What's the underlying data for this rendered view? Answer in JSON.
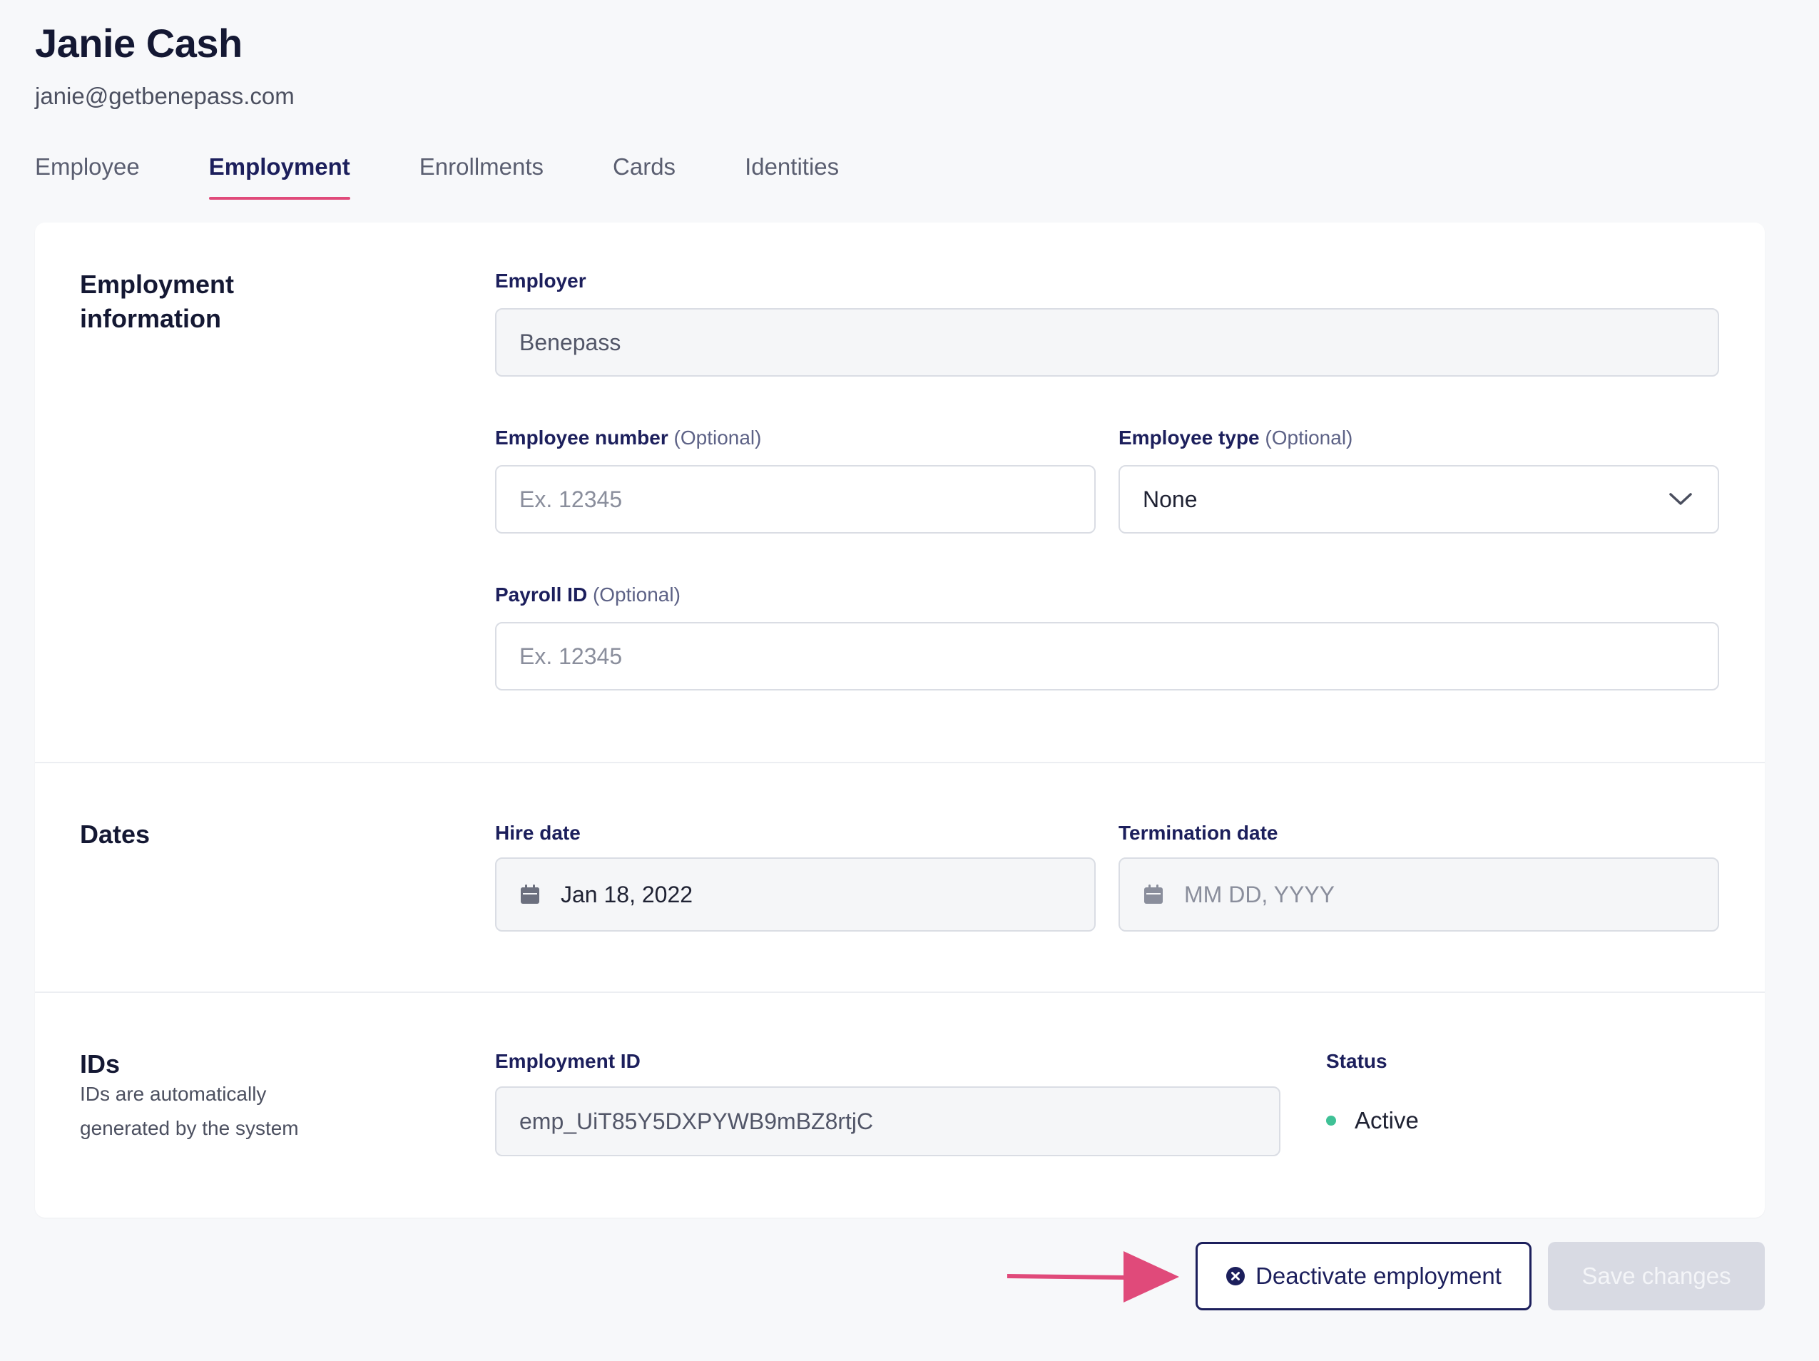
{
  "user": {
    "name": "Janie Cash",
    "email": "janie@getbenepass.com"
  },
  "tabs": [
    {
      "label": "Employee",
      "active": false
    },
    {
      "label": "Employment",
      "active": true
    },
    {
      "label": "Enrollments",
      "active": false
    },
    {
      "label": "Cards",
      "active": false
    },
    {
      "label": "Identities",
      "active": false
    }
  ],
  "employment": {
    "title": "Employment information",
    "employer": {
      "label": "Employer",
      "value": "Benepass"
    },
    "employee_number": {
      "label": "Employee number",
      "optional": "(Optional)",
      "placeholder": "Ex. 12345"
    },
    "employee_type": {
      "label": "Employee type",
      "optional": "(Optional)",
      "value": "None"
    },
    "payroll_id": {
      "label": "Payroll ID",
      "optional": "(Optional)",
      "placeholder": "Ex. 12345"
    }
  },
  "dates": {
    "title": "Dates",
    "hire_date": {
      "label": "Hire date",
      "value": "Jan 18, 2022"
    },
    "termination_date": {
      "label": "Termination date",
      "placeholder": "MM DD, YYYY"
    }
  },
  "ids": {
    "title": "IDs",
    "subtitle": "IDs are automatically generated by the system",
    "employment_id": {
      "label": "Employment ID",
      "value": "emp_UiT85Y5DXPYWB9mBZ8rtjC"
    },
    "status": {
      "label": "Status",
      "value": "Active"
    }
  },
  "actions": {
    "deactivate_label": "Deactivate employment",
    "save_label": "Save changes"
  },
  "colors": {
    "accent": "#e04a7a",
    "primary": "#1c1f5c",
    "status_active": "#3fc196",
    "disabled_button": "#d8dae3"
  },
  "icons": {
    "calendar": "calendar-icon",
    "chevron": "chevron-down-icon",
    "close_circle": "close-circle-icon",
    "annotation_arrow": "arrow-right-icon"
  }
}
